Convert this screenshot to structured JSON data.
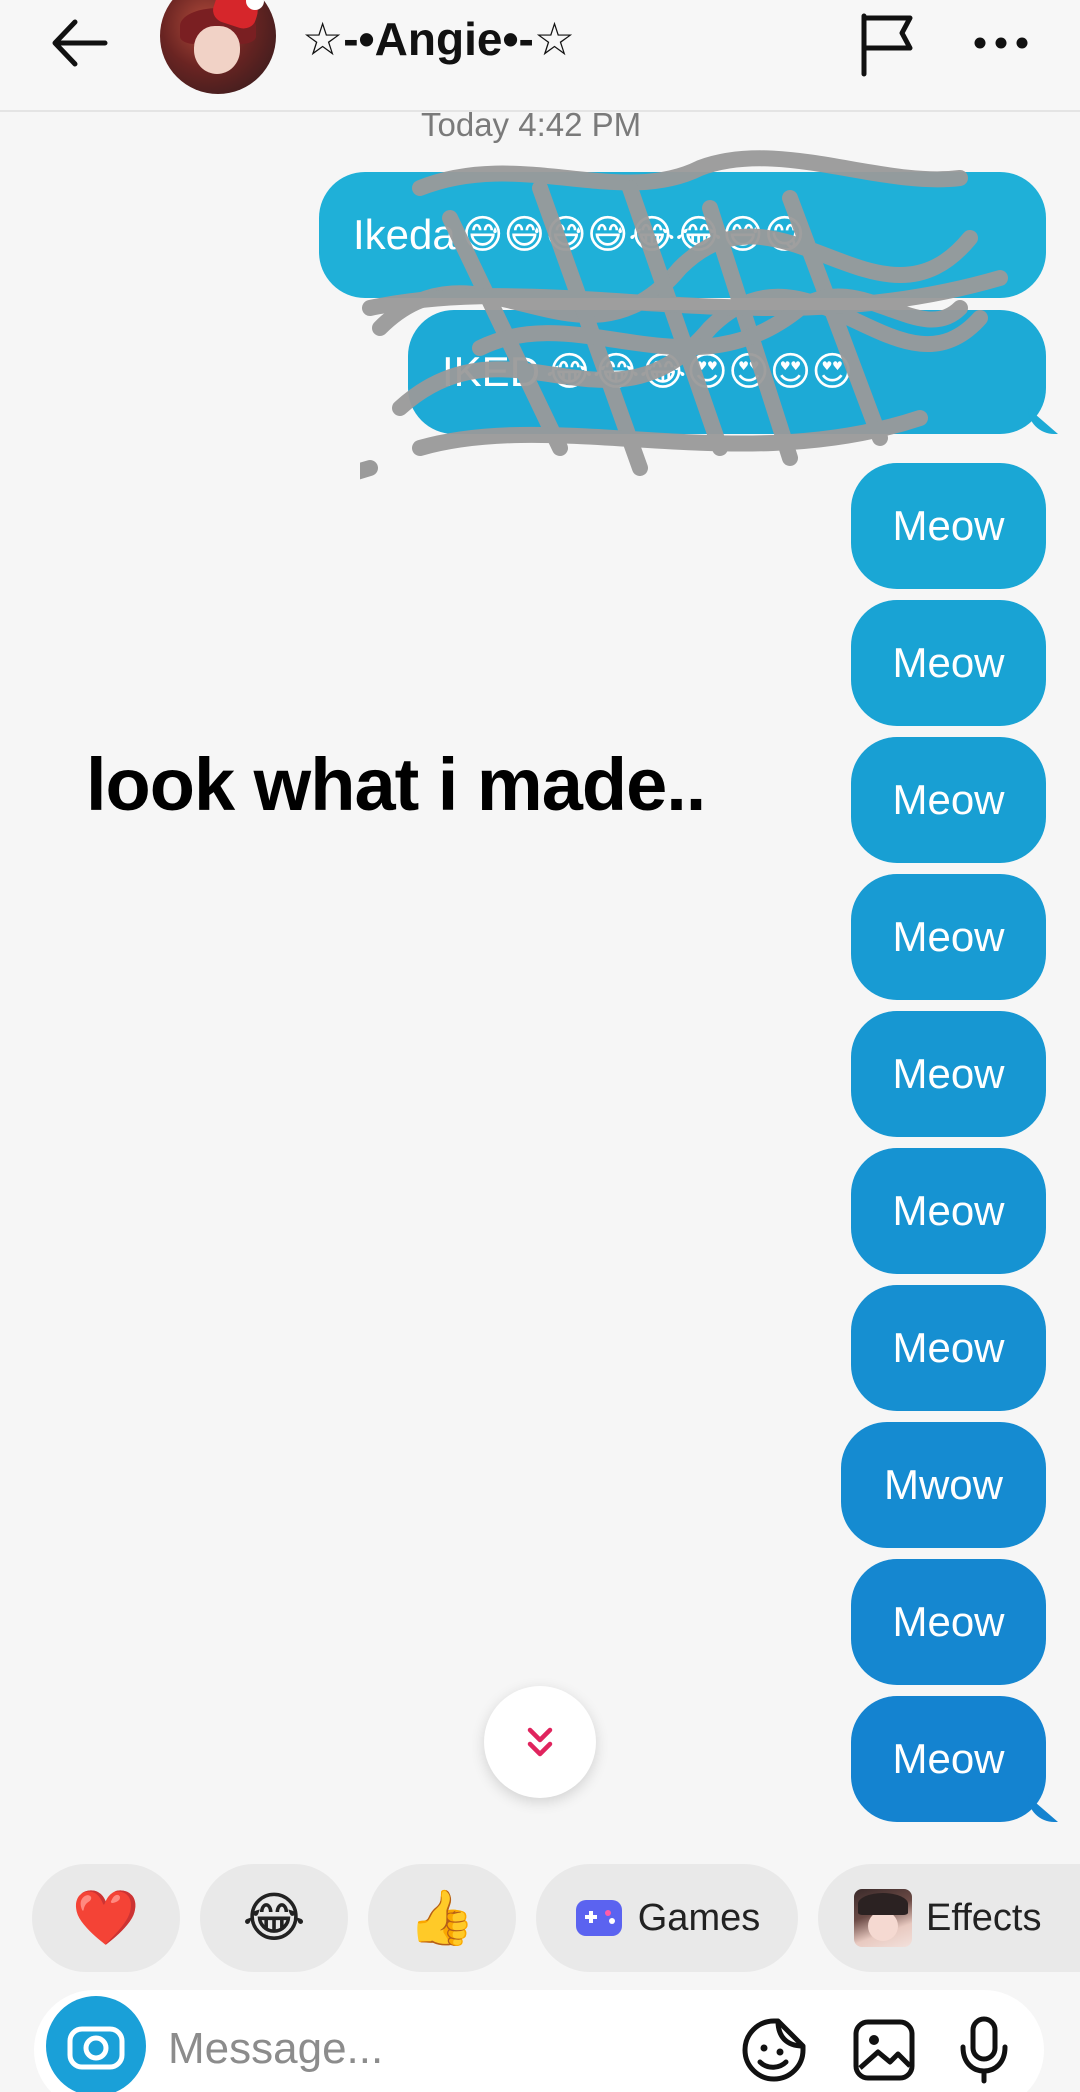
{
  "header": {
    "title": "☆-•Angie•-☆",
    "back_icon": "arrow-left-icon",
    "flag_icon": "flag-icon",
    "more_icon": "more-horizontal-icon"
  },
  "thread": {
    "timestamp": "Today 4:42 PM",
    "sent_messages": [
      {
        "text": "Ikeda",
        "color": "#1fb0d8"
      },
      {
        "text": "IKED",
        "color": "#1daad6"
      },
      {
        "text": "Meow",
        "color": "#1aa7d5"
      },
      {
        "text": "Meow",
        "color": "#19a3d4"
      },
      {
        "text": "Meow",
        "color": "#189fd3"
      },
      {
        "text": "Meow",
        "color": "#189bd3"
      },
      {
        "text": "Meow",
        "color": "#1797d2"
      },
      {
        "text": "Meow",
        "color": "#1693d2"
      },
      {
        "text": "Meow",
        "color": "#168fd1"
      },
      {
        "text": "Mwow",
        "color": "#158bd1"
      },
      {
        "text": "Meow",
        "color": "#1587d0"
      },
      {
        "text": "Meow",
        "color": "#1483d0"
      }
    ],
    "redacted_emojis_1": "😅😅😅😅😂😂😅😋",
    "redacted_emojis_2": "😂😂😂😍😍😍😍"
  },
  "overlay_caption": "look what i made..",
  "quick_actions": {
    "heart": "❤️",
    "laugh": "😂",
    "thumbs_up": "👍",
    "games_label": "Games",
    "effects_label": "Effects"
  },
  "composer": {
    "placeholder": "Message..."
  },
  "colors": {
    "accent_blue": "#1aa0d8",
    "background": "#f6f6f6",
    "chevron_pink": "#e0245e"
  }
}
